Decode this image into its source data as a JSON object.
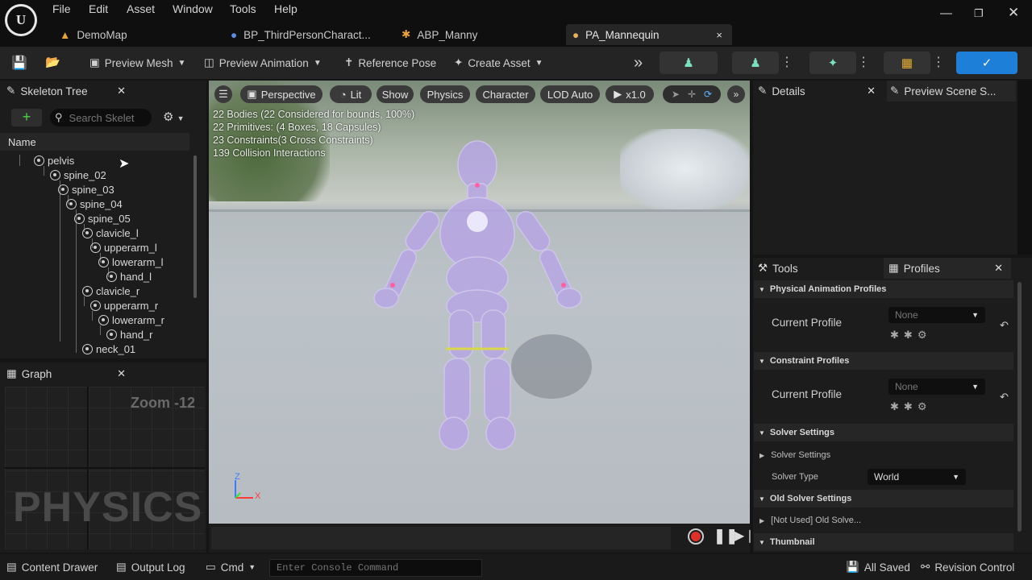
{
  "app": {
    "logo": "U"
  },
  "menu": [
    "File",
    "Edit",
    "Asset",
    "Window",
    "Tools",
    "Help"
  ],
  "tabs": [
    {
      "label": "DemoMap",
      "icon": "map-icon"
    },
    {
      "label": "BP_ThirdPersonCharact...",
      "icon": "blueprint-person-icon"
    },
    {
      "label": "ABP_Manny",
      "icon": "anim-blueprint-icon"
    },
    {
      "label": "PA_Mannequin",
      "icon": "physics-asset-icon",
      "close": "×"
    }
  ],
  "toolbar": {
    "preview_mesh": "Preview Mesh",
    "preview_animation": "Preview Animation",
    "reference_pose": "Reference Pose",
    "create_asset": "Create Asset",
    "more": "»"
  },
  "skeleton_tree": {
    "title": "Skeleton Tree",
    "search_placeholder": "Search Skelet",
    "column": "Name",
    "bones": [
      "pelvis",
      "spine_02",
      "spine_03",
      "spine_04",
      "spine_05",
      "clavicle_l",
      "upperarm_l",
      "lowerarm_l",
      "hand_l",
      "clavicle_r",
      "upperarm_r",
      "lowerarm_r",
      "hand_r",
      "neck_01"
    ]
  },
  "graph": {
    "title": "Graph",
    "zoom": "Zoom -12",
    "watermark": "PHYSICS"
  },
  "viewport": {
    "buttons": [
      "Perspective",
      "Lit",
      "Show",
      "Physics",
      "Character",
      "LOD Auto",
      "x1.0"
    ],
    "stats": [
      "22 Bodies (22 Considered for bounds, 100%)",
      "22 Primitives: (4 Boxes, 18 Capsules)",
      "23 Constraints(3 Cross Constraints)",
      "139 Collision Interactions"
    ],
    "axis_z": "Z",
    "axis_x": "X"
  },
  "details": {
    "title": "Details",
    "preview_scene": "Preview Scene S..."
  },
  "profiles": {
    "tools_tab": "Tools",
    "profiles_tab": "Profiles",
    "sections": {
      "physical_animation": "Physical Animation Profiles",
      "constraint": "Constraint Profiles",
      "solver": "Solver Settings",
      "old_solver": "Old Solver Settings",
      "thumbnail": "Thumbnail"
    },
    "current_profile": "Current Profile",
    "none": "None",
    "solver_settings_row": "Solver Settings",
    "solver_type_label": "Solver Type",
    "solver_type_value": "World",
    "old_solver_row": "[Not Used] Old Solve..."
  },
  "statusbar": {
    "content_drawer": "Content Drawer",
    "output_log": "Output Log",
    "cmd": "Cmd",
    "console_placeholder": "Enter Console Command",
    "all_saved": "All Saved",
    "revision_control": "Revision Control"
  },
  "colors": {
    "accent": "#1e7fd8",
    "bg": "#151515",
    "panel": "#1c1c1c"
  }
}
